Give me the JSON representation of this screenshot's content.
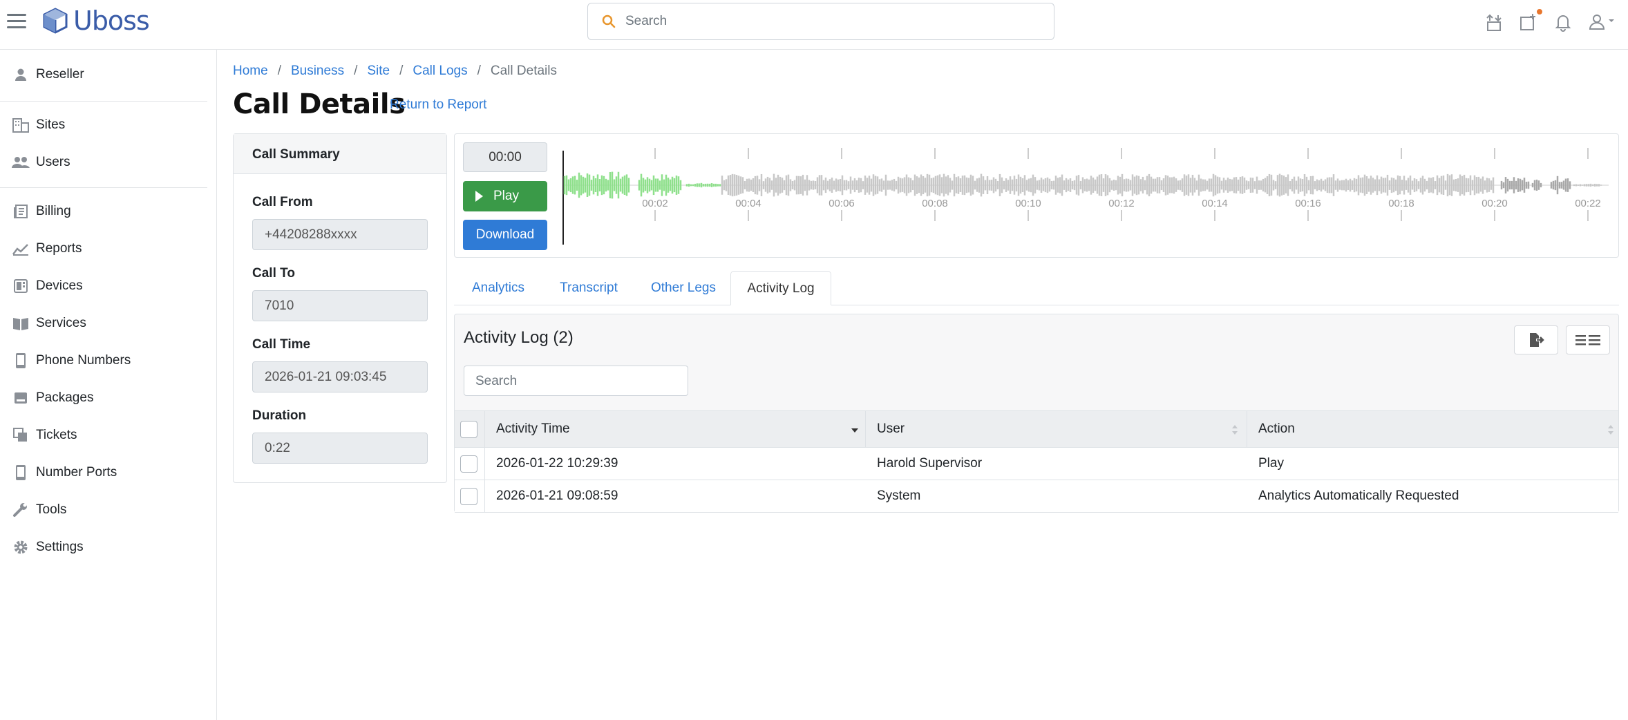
{
  "header": {
    "app_name": "Uboss",
    "search_placeholder": "Search",
    "accent_color": "#3a5ca8",
    "notification_dot_color": "#e8762d",
    "icons": [
      "menu-icon",
      "transfer-icon",
      "add-ticket-icon",
      "bell-icon",
      "user-icon"
    ]
  },
  "sidebar": {
    "items": [
      {
        "label": "Reseller",
        "icon": "person-icon"
      },
      {
        "label": "Sites",
        "icon": "building-icon"
      },
      {
        "label": "Users",
        "icon": "users-icon"
      },
      {
        "label": "Billing",
        "icon": "billing-icon"
      },
      {
        "label": "Reports",
        "icon": "chart-icon"
      },
      {
        "label": "Devices",
        "icon": "devices-icon"
      },
      {
        "label": "Services",
        "icon": "book-icon"
      },
      {
        "label": "Phone Numbers",
        "icon": "phone-icon"
      },
      {
        "label": "Packages",
        "icon": "package-icon"
      },
      {
        "label": "Tickets",
        "icon": "tickets-icon"
      },
      {
        "label": "Number Ports",
        "icon": "port-icon"
      },
      {
        "label": "Tools",
        "icon": "wrench-icon"
      },
      {
        "label": "Settings",
        "icon": "gear-icon"
      }
    ]
  },
  "breadcrumb": {
    "items": [
      "Home",
      "Business",
      "Site",
      "Call Logs"
    ],
    "current": "Call Details"
  },
  "page": {
    "title": "Call Details",
    "return_link": "Return to Report"
  },
  "summary": {
    "heading": "Call Summary",
    "fields": [
      {
        "label": "Call From",
        "value": "+44208288xxxx"
      },
      {
        "label": "Call To",
        "value": "7010"
      },
      {
        "label": "Call Time",
        "value": "2026-01-21 09:03:45"
      },
      {
        "label": "Duration",
        "value": "0:22"
      }
    ]
  },
  "player": {
    "current_time": "00:00",
    "play_label": "Play",
    "download_label": "Download",
    "played_color": "#8fe08c",
    "unplayed_color": "#c8c8c8",
    "timeline_labels": [
      "00:02",
      "00:04",
      "00:06",
      "00:08",
      "00:10",
      "00:12",
      "00:14",
      "00:16",
      "00:18",
      "00:20",
      "00:22"
    ]
  },
  "tabs": {
    "items": [
      "Analytics",
      "Transcript",
      "Other Legs",
      "Activity Log"
    ],
    "active": "Activity Log"
  },
  "activity_log": {
    "title": "Activity Log (2)",
    "search_placeholder": "Search",
    "columns": [
      "Activity Time",
      "User",
      "Action"
    ],
    "rows": [
      {
        "time": "2026-01-22 10:29:39",
        "user": "Harold Supervisor",
        "action": "Play"
      },
      {
        "time": "2026-01-21 09:08:59",
        "user": "System",
        "action": "Analytics Automatically Requested"
      }
    ]
  }
}
